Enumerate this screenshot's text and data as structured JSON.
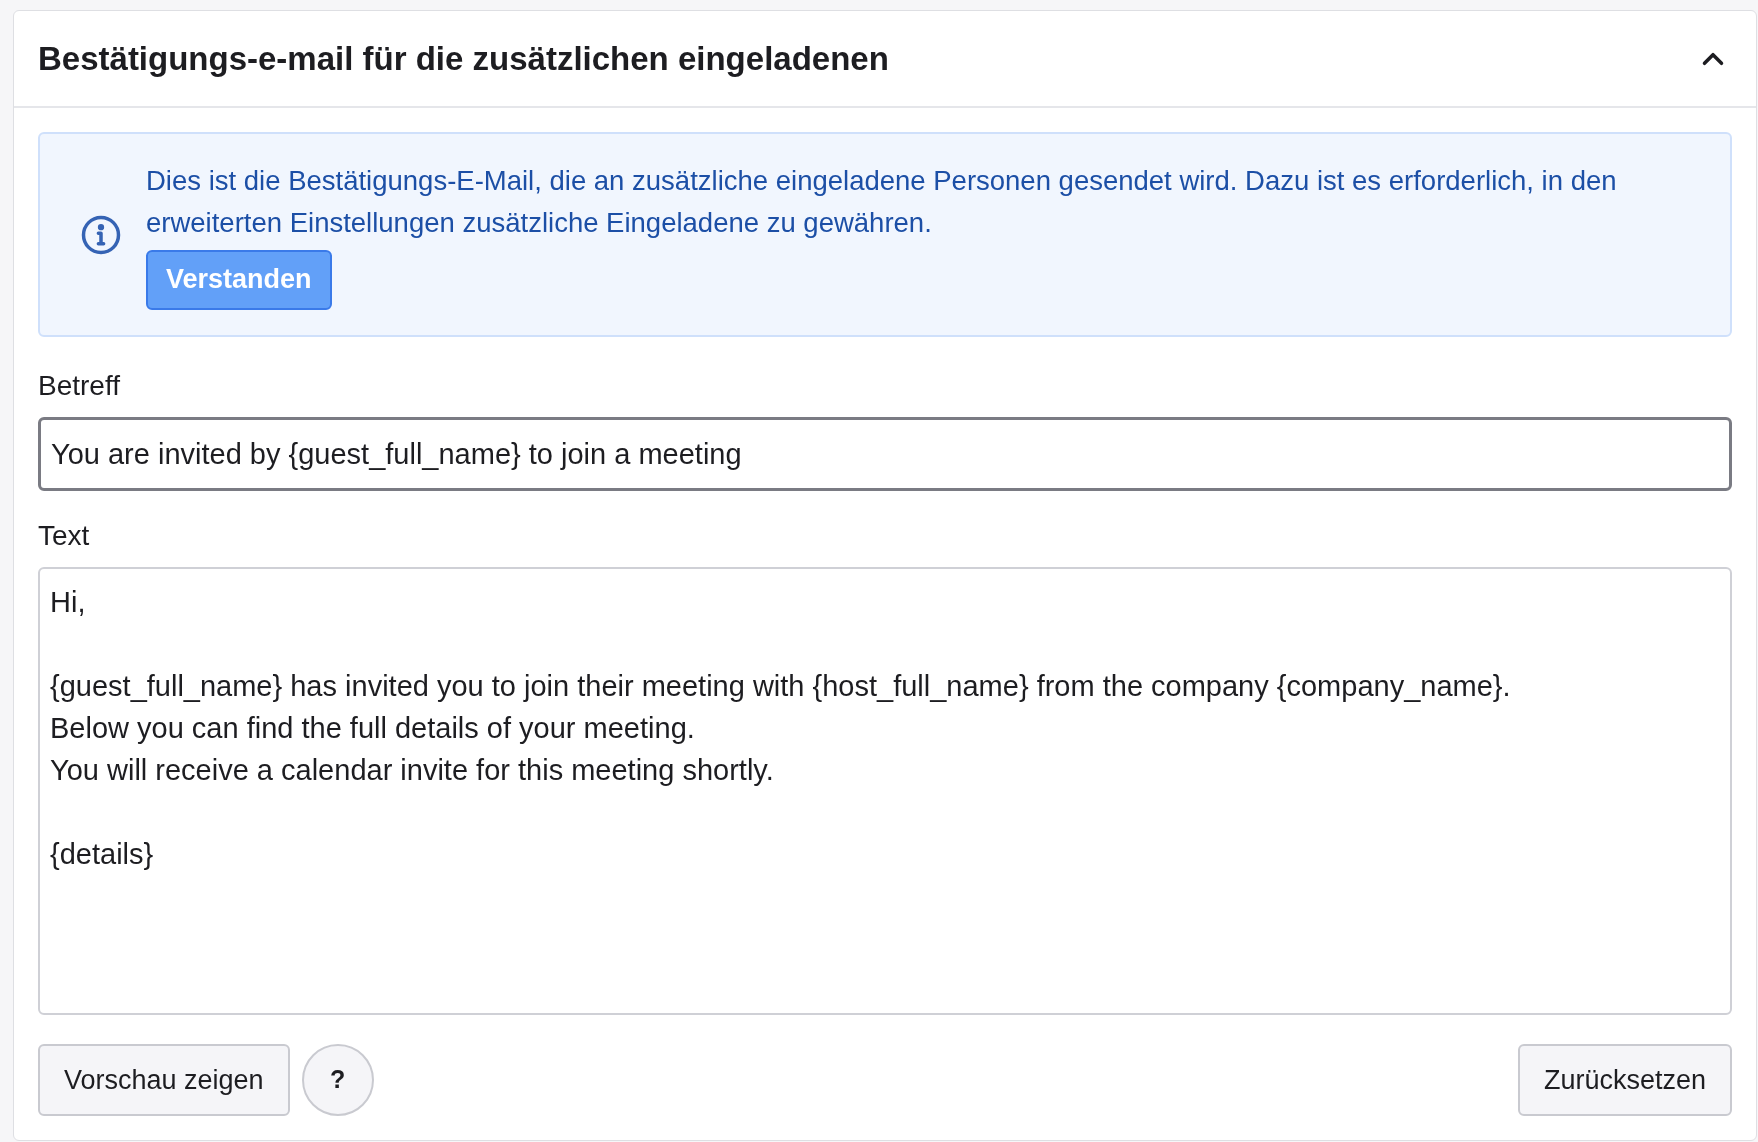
{
  "panel": {
    "title": "Bestätigungs-e-mail für die zusätzlichen eingeladenen",
    "expanded": true
  },
  "notice": {
    "text": "Dies ist die Bestätigungs-E-Mail, die an zusätzliche eingeladene Personen gesendet wird. Dazu ist es erforderlich, in den erweiterten Einstellungen zusätzliche Eingeladene zu gewähren.",
    "button": "Verstanden"
  },
  "subject": {
    "label": "Betreff",
    "value": "You are invited by {guest_full_name} to join a meeting"
  },
  "body": {
    "label": "Text",
    "value": "Hi,\n\n{guest_full_name} has invited you to join their meeting with {host_full_name} from the company {company_name}.\nBelow you can find the full details of your meeting.\nYou will receive a calendar invite for this meeting shortly.\n\n{details}"
  },
  "buttons": {
    "preview": "Vorschau zeigen",
    "help": "?",
    "reset": "Zurücksetzen"
  }
}
